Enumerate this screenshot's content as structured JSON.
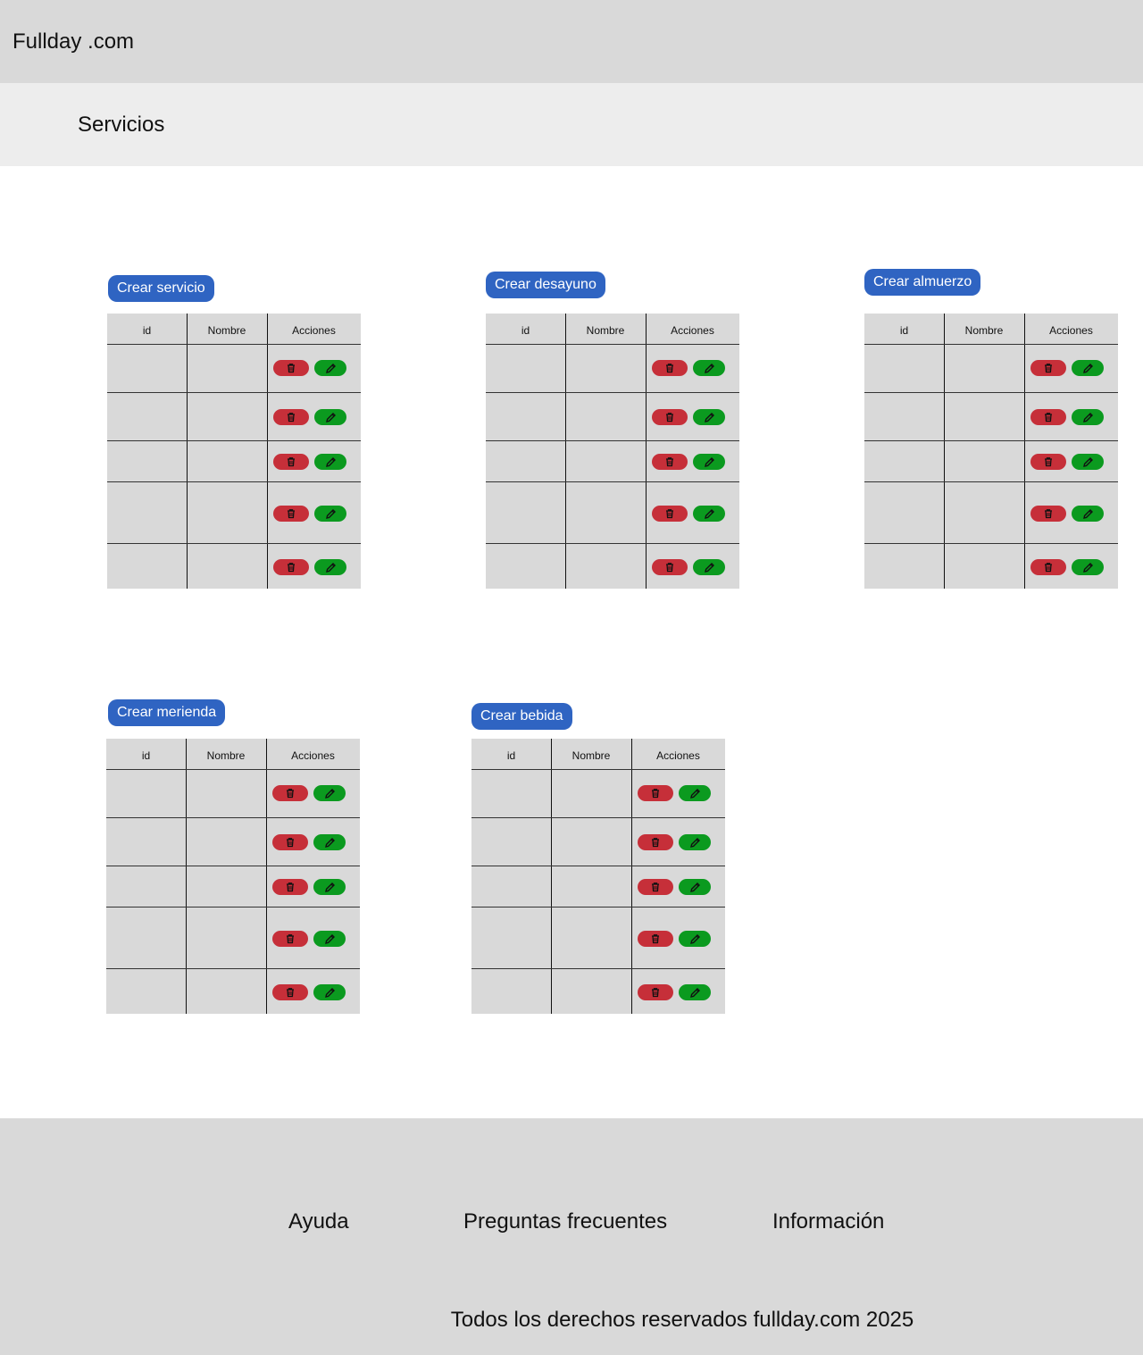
{
  "header": {
    "brand": "Fullday .com"
  },
  "subheader": {
    "title": "Servicios"
  },
  "table_headers": {
    "id": "id",
    "name": "Nombre",
    "actions": "Acciones"
  },
  "sections": [
    {
      "key": "servicio",
      "create_label": "Crear servicio",
      "rows": 5
    },
    {
      "key": "desayuno",
      "create_label": "Crear desayuno",
      "rows": 5
    },
    {
      "key": "almuerzo",
      "create_label": "Crear almuerzo",
      "rows": 5
    },
    {
      "key": "merienda",
      "create_label": "Crear merienda",
      "rows": 5
    },
    {
      "key": "bebida",
      "create_label": "Crear bebida",
      "rows": 5
    }
  ],
  "icons": {
    "delete": "trash-icon",
    "edit": "pencil-icon"
  },
  "colors": {
    "create_button": "#2f64c2",
    "delete_button": "#c62f39",
    "edit_button": "#0b9a1f",
    "header_bg": "#d9d9d9",
    "subheader_bg": "#ededed"
  },
  "footer": {
    "links": [
      "Ayuda",
      "Preguntas frecuentes",
      "Información"
    ],
    "copyright": "Todos los derechos reservados fullday.com 2025"
  }
}
